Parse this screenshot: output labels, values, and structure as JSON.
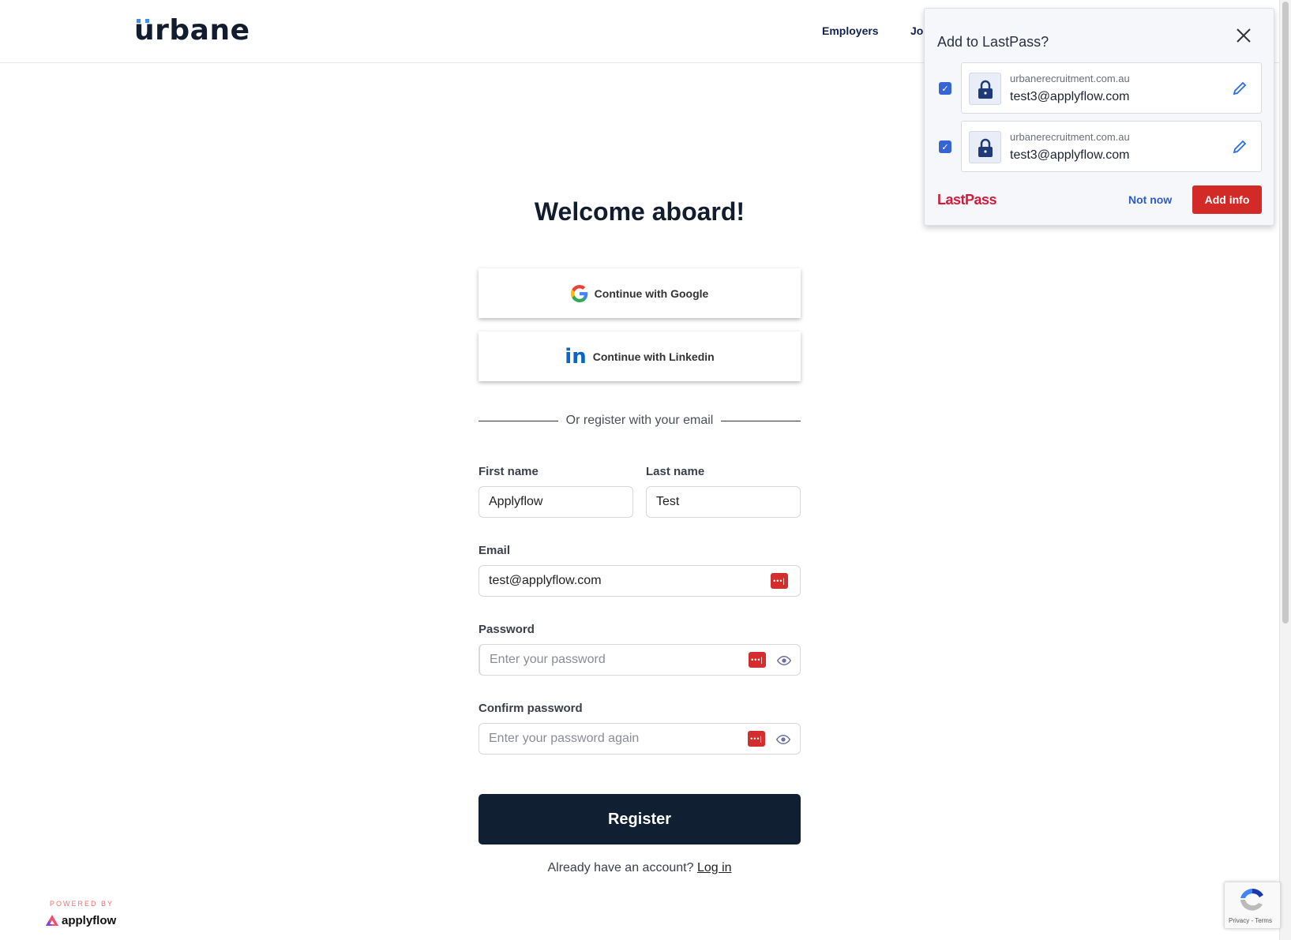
{
  "header": {
    "logo": "urbane",
    "nav": [
      "Employers",
      "Jo"
    ]
  },
  "main": {
    "title": "Welcome aboard!",
    "google_label": "Continue with Google",
    "linkedin_label": "Continue with Linkedin",
    "divider_text": "Or register with your email",
    "first_name": {
      "label": "First name",
      "value": "Applyflow"
    },
    "last_name": {
      "label": "Last name",
      "value": "Test"
    },
    "email": {
      "label": "Email",
      "value": "test@applyflow.com"
    },
    "password": {
      "label": "Password",
      "placeholder": "Enter your password"
    },
    "confirm": {
      "label": "Confirm password",
      "placeholder": "Enter your password again"
    },
    "register_label": "Register",
    "already_text": "Already have an account?",
    "login_link": "Log in"
  },
  "footer": {
    "powered_by": "POWERED BY",
    "brand": "applyflow"
  },
  "lastpass": {
    "title": "Add to LastPass?",
    "items": [
      {
        "domain": "urbanerecruitment.com.au",
        "username": "test3@applyflow.com",
        "checked": true
      },
      {
        "domain": "urbanerecruitment.com.au",
        "username": "test3@applyflow.com",
        "checked": true
      }
    ],
    "brand": "LastPass",
    "not_now": "Not now",
    "add_info": "Add info"
  },
  "recaptcha": {
    "links": "Privacy - Terms"
  },
  "colors": {
    "navy": "#111f33",
    "lastpass_red": "#d22a26",
    "link_blue": "#2c5bcc"
  }
}
